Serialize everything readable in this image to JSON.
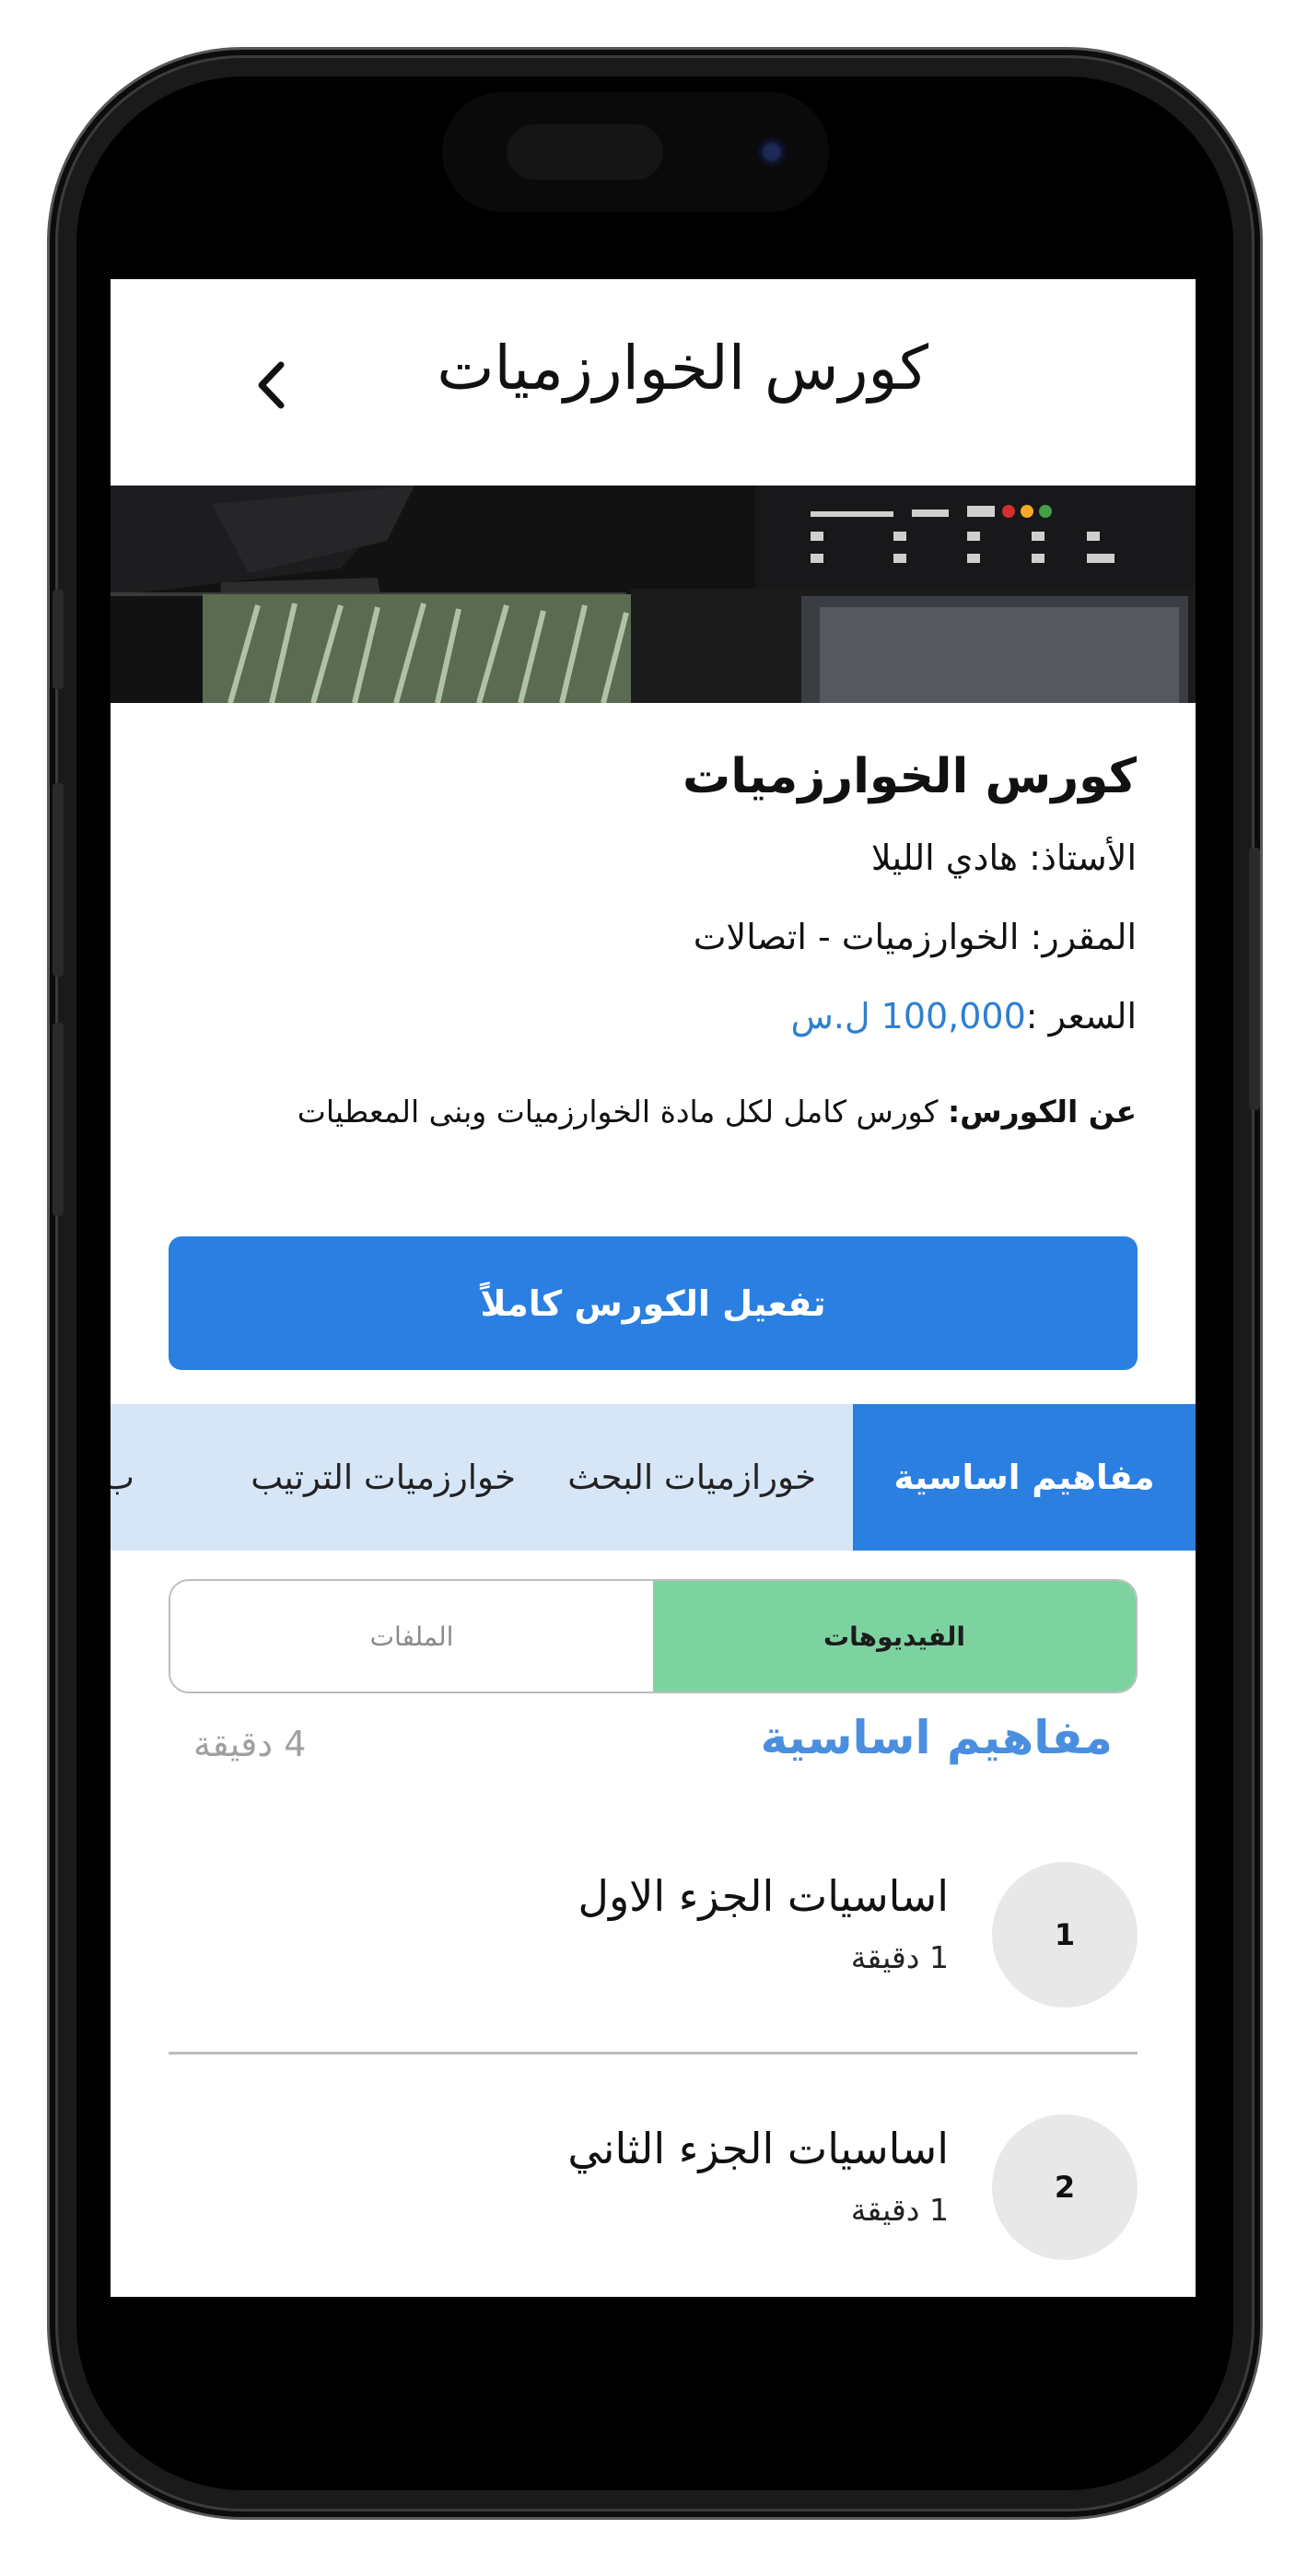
{
  "header": {
    "title": "كورس الخوارزميات"
  },
  "course": {
    "name": "كورس الخوارزميات",
    "instructor": "الأستاذ: هادي الليلا",
    "subject": "المقرر: الخوارزميات - اتصالات",
    "price_label": "السعر :",
    "price_value": "100,000 ل.س",
    "about_label": "عن الكورس:",
    "about_text": "كورس كامل لكل مادة الخوارزميات وبنى المعطيات"
  },
  "actions": {
    "activate_label": "تفعيل الكورس كاملاً"
  },
  "chapter_tabs": [
    {
      "label": "مفاهيم اساسية",
      "active": true
    },
    {
      "label": "خورازميات البحث",
      "active": false
    },
    {
      "label": "خوارزميات الترتيب",
      "active": false
    },
    {
      "label": "ب",
      "active": false
    }
  ],
  "content_tabs": {
    "videos": "الفيديوهات",
    "files": "الملفات",
    "selected": "videos"
  },
  "section": {
    "title": "مفاهيم اساسية",
    "duration": "4 دقيقة"
  },
  "lessons": [
    {
      "number": "1",
      "title": "اساسيات الجزء الاول",
      "duration": "1 دقيقة"
    },
    {
      "number": "2",
      "title": "اساسيات الجزء الثاني",
      "duration": "1 دقيقة"
    }
  ],
  "colors": {
    "primary": "#2a7fe0",
    "tabs_background": "#d7e6f7",
    "segment_active": "#7dd3a0",
    "section_title": "#4a8fdf",
    "price": "#2f7fd1"
  },
  "icons": {
    "back": "chevron-left-icon"
  }
}
